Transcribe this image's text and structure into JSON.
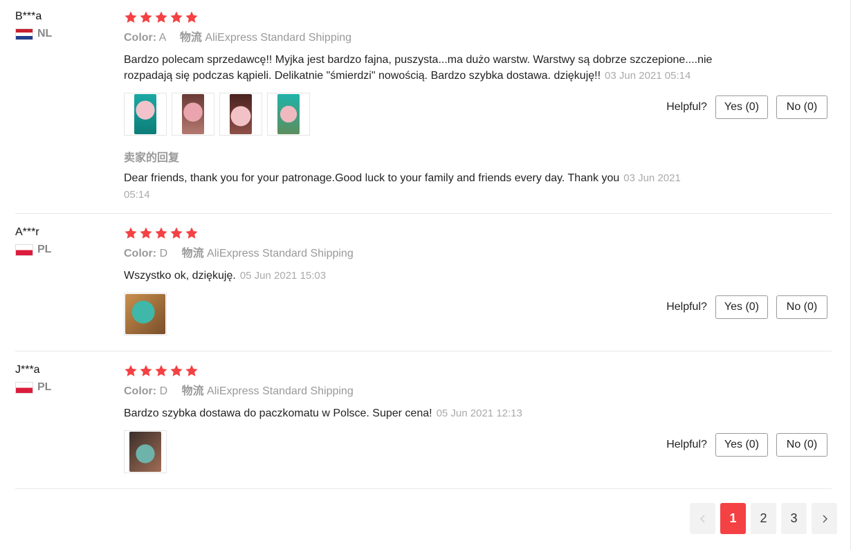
{
  "helpful_label": "Helpful?",
  "reviews": [
    {
      "user": "B***a",
      "country": "NL",
      "stars": 5,
      "color_label": "Color:",
      "color_value": "A",
      "shipping_label": "物流",
      "shipping_value": "AliExpress Standard Shipping",
      "text": "Bardzo polecam sprzedawcę!! Myjka jest bardzo fajna, puszysta...ma dużo warstw. Warstwy są dobrze szczepione....nie rozpadają się podczas kąpieli. Delikatnie \"śmierdzi\" nowością. Bardzo szybka dostawa. dziękuję!!",
      "time": "03 Jun 2021 05:14",
      "yes": "Yes (0)",
      "no": "No (0)",
      "reply_title": "卖家的回复",
      "reply_text": "Dear friends, thank you for your patronage.Good luck to your family and friends every day. Thank you",
      "reply_time": "03 Jun 2021 05:14"
    },
    {
      "user": "A***r",
      "country": "PL",
      "stars": 5,
      "color_label": "Color:",
      "color_value": "D",
      "shipping_label": "物流",
      "shipping_value": "AliExpress Standard Shipping",
      "text": "Wszystko ok, dziękuję.",
      "time": "05 Jun 2021 15:03",
      "yes": "Yes (0)",
      "no": "No (0)"
    },
    {
      "user": "J***a",
      "country": "PL",
      "stars": 5,
      "color_label": "Color:",
      "color_value": "D",
      "shipping_label": "物流",
      "shipping_value": "AliExpress Standard Shipping",
      "text": "Bardzo szybka dostawa do paczkomatu w Polsce. Super cena!",
      "time": "05 Jun 2021 12:13",
      "yes": "Yes (0)",
      "no": "No (0)"
    }
  ],
  "pagination": {
    "pages": [
      "1",
      "2",
      "3"
    ],
    "current": "1",
    "prev_icon": "chevron-left-icon",
    "next_icon": "chevron-right-icon"
  },
  "colors": {
    "star": "#f44144",
    "active_page": "#f44144",
    "muted_text": "#999999"
  }
}
